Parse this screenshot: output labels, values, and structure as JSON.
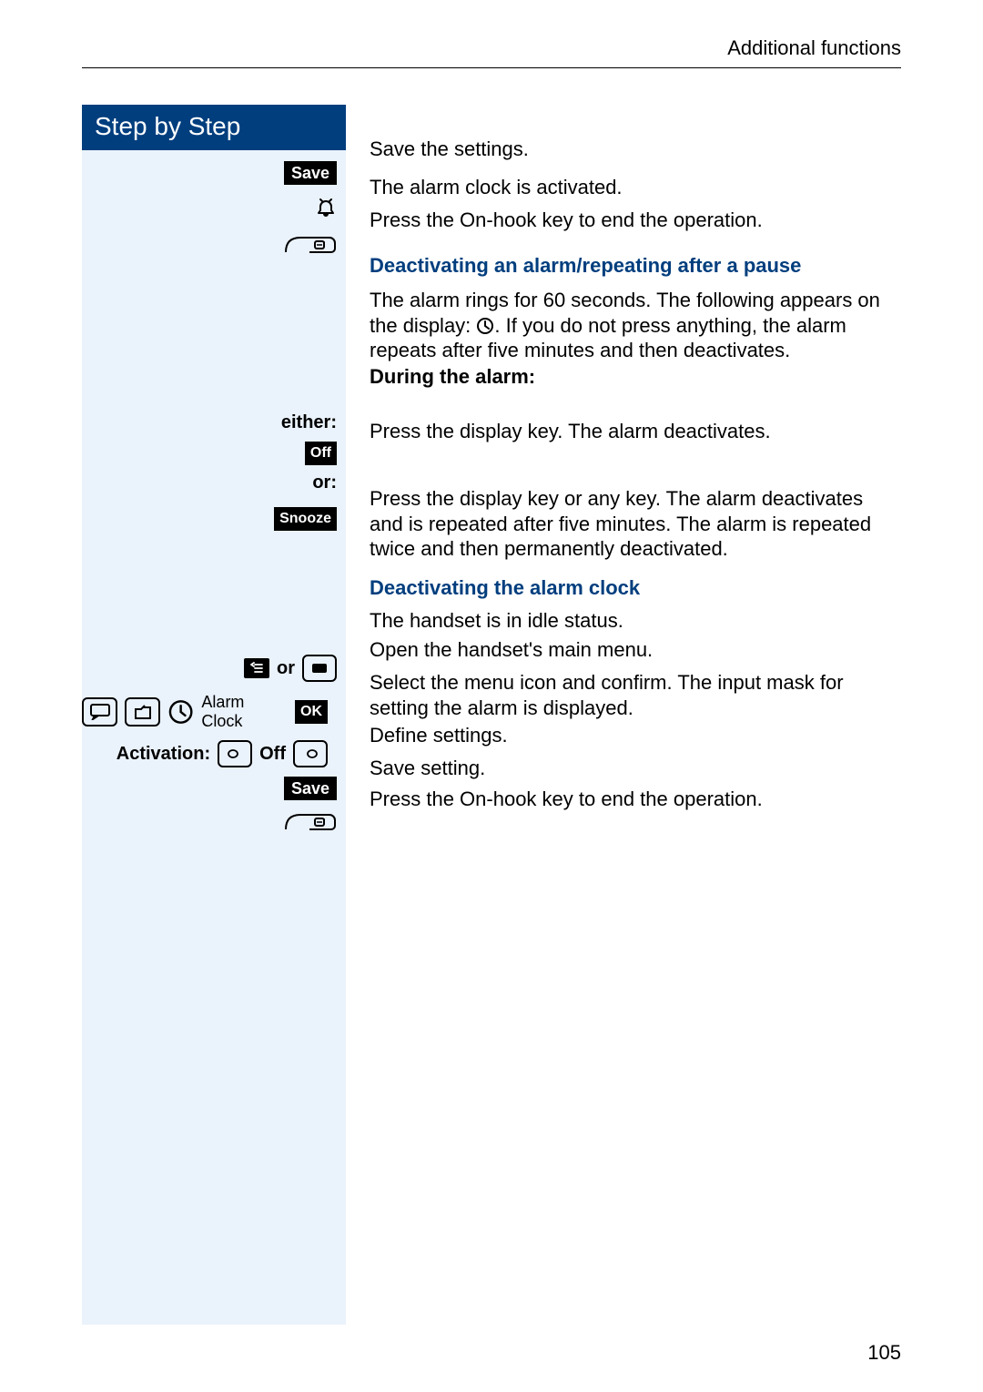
{
  "header": {
    "section_title": "Additional functions"
  },
  "sidebar": {
    "title": "Step by Step",
    "labels": {
      "save": "Save",
      "either": "either:",
      "off": "Off",
      "or": "or:",
      "snooze": "Snooze",
      "or_word": "or",
      "menu_item": "Alarm Clock",
      "ok": "OK",
      "activation_label": "Activation:",
      "activation_value": "Off",
      "save2": "Save"
    }
  },
  "content": {
    "r1": "Save the settings.",
    "r2": "The alarm clock is activated.",
    "r3": "Press the On-hook key to end the operation.",
    "h1": "Deactivating an alarm/repeating after a pause",
    "p1a": "The alarm rings for 60 seconds. The following appears on the display: ",
    "p1b": ". If you do not press anything, the alarm repeats after five minutes and then deactivates.",
    "h2": "During the alarm:",
    "r4": "Press the display key. The alarm deactivates.",
    "r5": "Press the display key or any key. The alarm deactivates and is repeated after five minutes. The alarm is repeated twice and then permanently deactivated.",
    "h3": "Deactivating the alarm clock",
    "r6": "The handset is in idle status.",
    "r7": "Open the handset's main menu.",
    "r8": "Select the menu icon and confirm. The input mask for setting the alarm is displayed.",
    "r9": "Define settings.",
    "r10": "Save setting.",
    "r11": "Press the On-hook key to end the operation."
  },
  "page_number": "105"
}
